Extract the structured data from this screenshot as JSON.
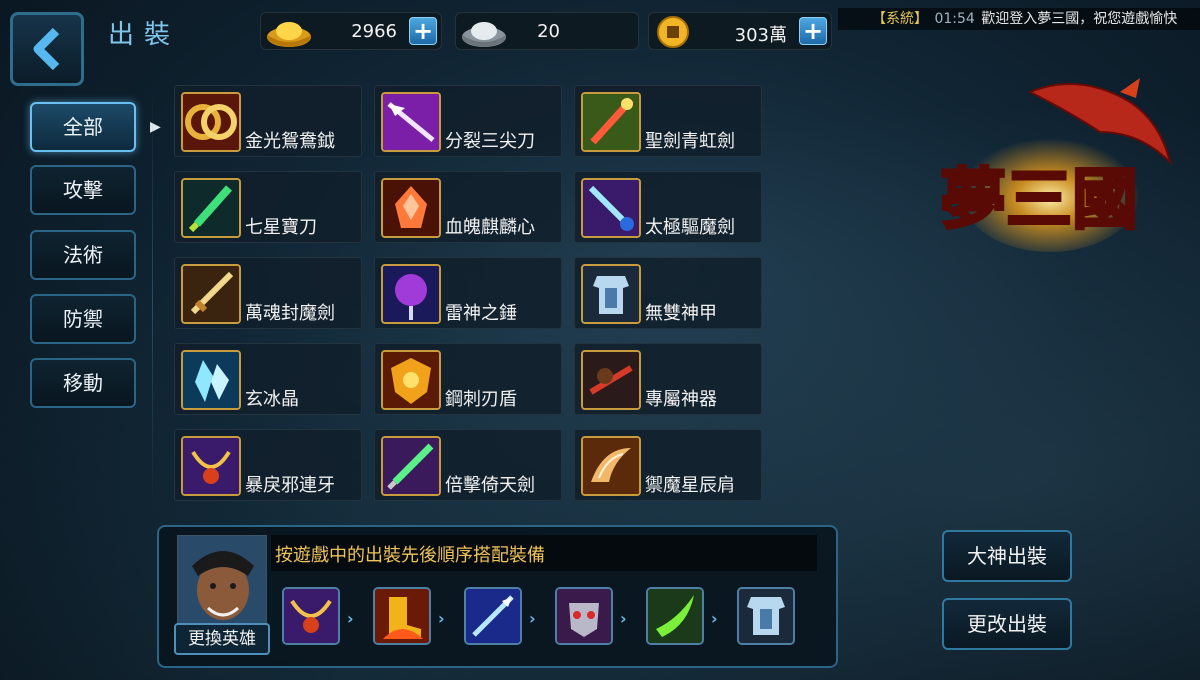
{
  "header": {
    "title": "出裝",
    "currencies": [
      {
        "name": "gold-ingot",
        "value": "2966"
      },
      {
        "name": "silver-ingot",
        "value": "20"
      },
      {
        "name": "coin",
        "value": "303萬"
      }
    ],
    "news": {
      "tag": "【系統】",
      "time": "01:54",
      "message": "歡迎登入夢三國，祝您遊戲愉快"
    }
  },
  "categories": [
    {
      "label": "全部",
      "active": true
    },
    {
      "label": "攻擊",
      "active": false
    },
    {
      "label": "法術",
      "active": false
    },
    {
      "label": "防禦",
      "active": false
    },
    {
      "label": "移動",
      "active": false
    }
  ],
  "items": [
    {
      "name": "金光鴛鴦鉞",
      "icon": "golden-rings-icon"
    },
    {
      "name": "分裂三尖刀",
      "icon": "trident-spear-icon"
    },
    {
      "name": "聖劍青虹劍",
      "icon": "red-sword-icon"
    },
    {
      "name": "七星寶刀",
      "icon": "green-dagger-icon"
    },
    {
      "name": "血魄麒麟心",
      "icon": "blood-crystal-icon"
    },
    {
      "name": "太極驅魔劍",
      "icon": "taiji-sword-icon"
    },
    {
      "name": "萬魂封魔劍",
      "icon": "golden-sword-icon"
    },
    {
      "name": "雷神之錘",
      "icon": "thunder-hammer-icon"
    },
    {
      "name": "無雙神甲",
      "icon": "armor-icon"
    },
    {
      "name": "玄冰晶",
      "icon": "ice-crystal-icon"
    },
    {
      "name": "鋼刺刃盾",
      "icon": "spiked-shield-icon"
    },
    {
      "name": "專屬神器",
      "icon": "exclusive-artifact-icon"
    },
    {
      "name": "暴戾邪連牙",
      "icon": "fang-necklace-icon"
    },
    {
      "name": "倍擊倚天劍",
      "icon": "jade-sword-icon"
    },
    {
      "name": "禦魔星辰肩",
      "icon": "star-shoulder-icon"
    }
  ],
  "build": {
    "hint": "按遊戲中的出裝先後順序搭配裝備",
    "change_hero_label": "更換英雄",
    "slots": [
      "fang-necklace-icon",
      "fire-boots-icon",
      "ice-spear-icon",
      "demon-mask-icon",
      "green-blade-icon",
      "armor-icon"
    ]
  },
  "actions": {
    "master_build": "大神出裝",
    "change_build": "更改出裝"
  },
  "logo": {
    "text": "夢三國"
  }
}
